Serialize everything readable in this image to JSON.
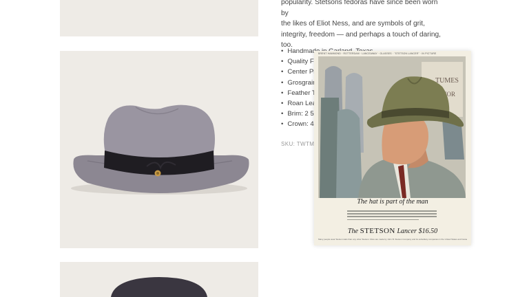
{
  "description": {
    "line1": "popularity. Stetsons fedoras have since been worn by",
    "line2": "the likes of Eliot Ness, and are symbols of grit,",
    "line3": "integrity, freedom — and perhaps a touch of daring,",
    "line4": "too."
  },
  "features": [
    "Handmade in Garland, Texas",
    "Quality Fu",
    "Center Pi",
    "Grosgrain",
    "Feather Ti",
    "Roan Leat",
    "Brim: 2 5/",
    "Crown: 4 "
  ],
  "sku": "SKU: TWTMF",
  "ad": {
    "topline": "BRENT HAMMOND · ROTTERDAM · LANCEAWAY · GLASSES · \"STETSON LANCER\" · IN PICTURE",
    "caption": "The hat is part of the man",
    "brand_prefix": "The",
    "brand_name": "STETSON",
    "brand_model": "Lancer",
    "brand_price": "$16.50",
    "fineprint": "Many people wear Stetson Hats than any other Stetson. More are made by John B. Stetson Company and its subsidiary companies in the United States and Canada.",
    "sign_text": "TUMES",
    "sign_text2": "NOR"
  },
  "colors": {
    "tile_bg": "#eeebe6",
    "hat_felt": "#8f8a95",
    "hat_band": "#1f1d22",
    "ad_paper": "#f3efe3",
    "ad_hat": "#767650",
    "ad_suit": "#8f9890"
  }
}
